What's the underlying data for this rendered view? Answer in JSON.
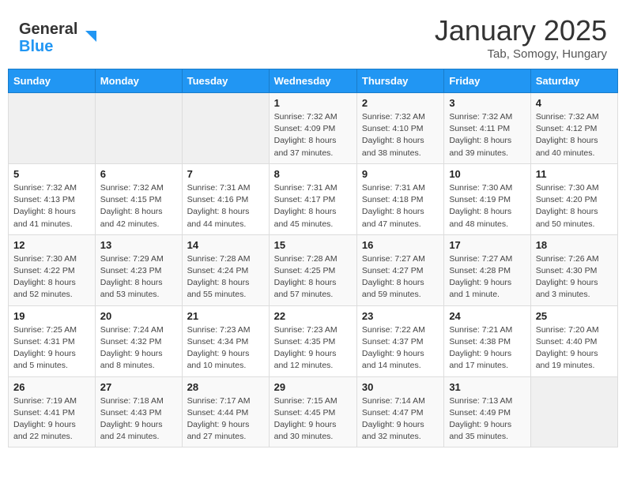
{
  "header": {
    "logo_general": "General",
    "logo_blue": "Blue",
    "month_title": "January 2025",
    "subtitle": "Tab, Somogy, Hungary"
  },
  "days_of_week": [
    "Sunday",
    "Monday",
    "Tuesday",
    "Wednesday",
    "Thursday",
    "Friday",
    "Saturday"
  ],
  "weeks": [
    [
      {
        "day": "",
        "info": ""
      },
      {
        "day": "",
        "info": ""
      },
      {
        "day": "",
        "info": ""
      },
      {
        "day": "1",
        "info": "Sunrise: 7:32 AM\nSunset: 4:09 PM\nDaylight: 8 hours and 37 minutes."
      },
      {
        "day": "2",
        "info": "Sunrise: 7:32 AM\nSunset: 4:10 PM\nDaylight: 8 hours and 38 minutes."
      },
      {
        "day": "3",
        "info": "Sunrise: 7:32 AM\nSunset: 4:11 PM\nDaylight: 8 hours and 39 minutes."
      },
      {
        "day": "4",
        "info": "Sunrise: 7:32 AM\nSunset: 4:12 PM\nDaylight: 8 hours and 40 minutes."
      }
    ],
    [
      {
        "day": "5",
        "info": "Sunrise: 7:32 AM\nSunset: 4:13 PM\nDaylight: 8 hours and 41 minutes."
      },
      {
        "day": "6",
        "info": "Sunrise: 7:32 AM\nSunset: 4:15 PM\nDaylight: 8 hours and 42 minutes."
      },
      {
        "day": "7",
        "info": "Sunrise: 7:31 AM\nSunset: 4:16 PM\nDaylight: 8 hours and 44 minutes."
      },
      {
        "day": "8",
        "info": "Sunrise: 7:31 AM\nSunset: 4:17 PM\nDaylight: 8 hours and 45 minutes."
      },
      {
        "day": "9",
        "info": "Sunrise: 7:31 AM\nSunset: 4:18 PM\nDaylight: 8 hours and 47 minutes."
      },
      {
        "day": "10",
        "info": "Sunrise: 7:30 AM\nSunset: 4:19 PM\nDaylight: 8 hours and 48 minutes."
      },
      {
        "day": "11",
        "info": "Sunrise: 7:30 AM\nSunset: 4:20 PM\nDaylight: 8 hours and 50 minutes."
      }
    ],
    [
      {
        "day": "12",
        "info": "Sunrise: 7:30 AM\nSunset: 4:22 PM\nDaylight: 8 hours and 52 minutes."
      },
      {
        "day": "13",
        "info": "Sunrise: 7:29 AM\nSunset: 4:23 PM\nDaylight: 8 hours and 53 minutes."
      },
      {
        "day": "14",
        "info": "Sunrise: 7:28 AM\nSunset: 4:24 PM\nDaylight: 8 hours and 55 minutes."
      },
      {
        "day": "15",
        "info": "Sunrise: 7:28 AM\nSunset: 4:25 PM\nDaylight: 8 hours and 57 minutes."
      },
      {
        "day": "16",
        "info": "Sunrise: 7:27 AM\nSunset: 4:27 PM\nDaylight: 8 hours and 59 minutes."
      },
      {
        "day": "17",
        "info": "Sunrise: 7:27 AM\nSunset: 4:28 PM\nDaylight: 9 hours and 1 minute."
      },
      {
        "day": "18",
        "info": "Sunrise: 7:26 AM\nSunset: 4:30 PM\nDaylight: 9 hours and 3 minutes."
      }
    ],
    [
      {
        "day": "19",
        "info": "Sunrise: 7:25 AM\nSunset: 4:31 PM\nDaylight: 9 hours and 5 minutes."
      },
      {
        "day": "20",
        "info": "Sunrise: 7:24 AM\nSunset: 4:32 PM\nDaylight: 9 hours and 8 minutes."
      },
      {
        "day": "21",
        "info": "Sunrise: 7:23 AM\nSunset: 4:34 PM\nDaylight: 9 hours and 10 minutes."
      },
      {
        "day": "22",
        "info": "Sunrise: 7:23 AM\nSunset: 4:35 PM\nDaylight: 9 hours and 12 minutes."
      },
      {
        "day": "23",
        "info": "Sunrise: 7:22 AM\nSunset: 4:37 PM\nDaylight: 9 hours and 14 minutes."
      },
      {
        "day": "24",
        "info": "Sunrise: 7:21 AM\nSunset: 4:38 PM\nDaylight: 9 hours and 17 minutes."
      },
      {
        "day": "25",
        "info": "Sunrise: 7:20 AM\nSunset: 4:40 PM\nDaylight: 9 hours and 19 minutes."
      }
    ],
    [
      {
        "day": "26",
        "info": "Sunrise: 7:19 AM\nSunset: 4:41 PM\nDaylight: 9 hours and 22 minutes."
      },
      {
        "day": "27",
        "info": "Sunrise: 7:18 AM\nSunset: 4:43 PM\nDaylight: 9 hours and 24 minutes."
      },
      {
        "day": "28",
        "info": "Sunrise: 7:17 AM\nSunset: 4:44 PM\nDaylight: 9 hours and 27 minutes."
      },
      {
        "day": "29",
        "info": "Sunrise: 7:15 AM\nSunset: 4:45 PM\nDaylight: 9 hours and 30 minutes."
      },
      {
        "day": "30",
        "info": "Sunrise: 7:14 AM\nSunset: 4:47 PM\nDaylight: 9 hours and 32 minutes."
      },
      {
        "day": "31",
        "info": "Sunrise: 7:13 AM\nSunset: 4:49 PM\nDaylight: 9 hours and 35 minutes."
      },
      {
        "day": "",
        "info": ""
      }
    ]
  ]
}
